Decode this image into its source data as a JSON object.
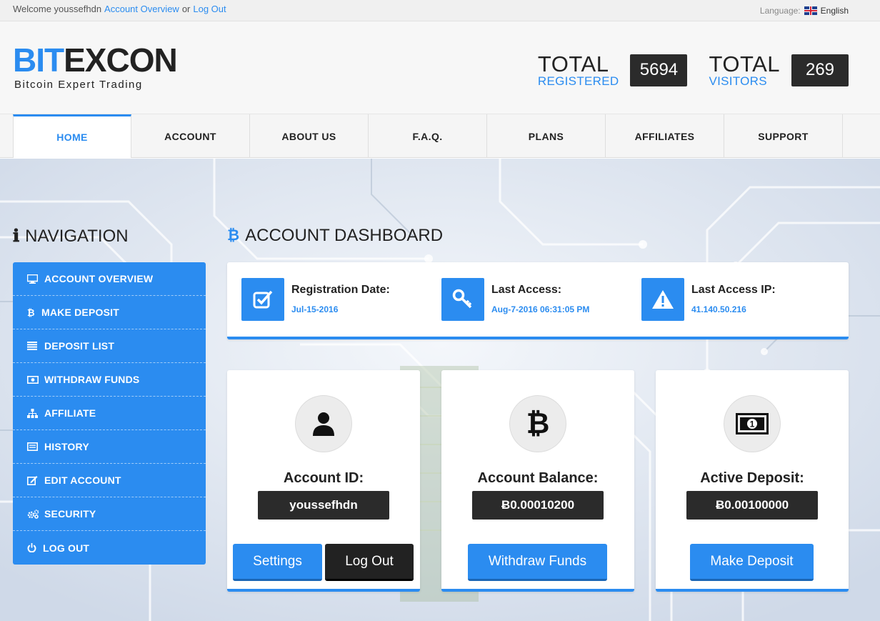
{
  "topbar": {
    "welcome": "Welcome youssefhdn",
    "overview_link": "Account Overview",
    "or": "or",
    "logout_link": "Log Out",
    "language_label": "Language:",
    "language_value": "English"
  },
  "logo": {
    "part1": "BIT",
    "part2": "EXCON",
    "tagline": "Bitcoin Expert Trading"
  },
  "stats": {
    "registered": {
      "title": "TOTAL",
      "subtitle": "REGISTERED",
      "value": "5694"
    },
    "visitors": {
      "title": "TOTAL",
      "subtitle": "VISITORS",
      "value": "269"
    }
  },
  "nav": [
    "HOME",
    "ACCOUNT",
    "ABOUT US",
    "F.A.Q.",
    "PLANS",
    "AFFILIATES",
    "SUPPORT"
  ],
  "navigation_title": "NAVIGATION",
  "dashboard_title": "ACCOUNT DASHBOARD",
  "sidebar": [
    {
      "label": "ACCOUNT OVERVIEW",
      "icon": "monitor-icon"
    },
    {
      "label": "MAKE DEPOSIT",
      "icon": "bitcoin-icon"
    },
    {
      "label": "DEPOSIT LIST",
      "icon": "list-icon"
    },
    {
      "label": "WITHDRAW FUNDS",
      "icon": "money-icon"
    },
    {
      "label": "AFFILIATE",
      "icon": "sitemap-icon"
    },
    {
      "label": "HISTORY",
      "icon": "history-list-icon"
    },
    {
      "label": "EDIT ACCOUNT",
      "icon": "edit-icon"
    },
    {
      "label": "SECURITY",
      "icon": "gears-icon"
    },
    {
      "label": "LOG OUT",
      "icon": "power-icon"
    }
  ],
  "info": {
    "registration": {
      "label": "Registration Date:",
      "value": "Jul-15-2016"
    },
    "last_access": {
      "label": "Last Access:",
      "value": "Aug-7-2016 06:31:05 PM"
    },
    "last_ip": {
      "label": "Last Access IP:",
      "value": "41.140.50.216"
    }
  },
  "cards": {
    "account_id": {
      "label": "Account ID:",
      "value": "youssefhdn",
      "btn1": "Settings",
      "btn2": "Log Out"
    },
    "balance": {
      "label": "Account Balance:",
      "value": "Ƀ0.00010200",
      "btn": "Withdraw Funds"
    },
    "deposit": {
      "label": "Active Deposit:",
      "value": "Ƀ0.00100000",
      "btn": "Make Deposit"
    }
  },
  "colors": {
    "accent": "#2b8cf0",
    "dark": "#2b2b2b"
  }
}
